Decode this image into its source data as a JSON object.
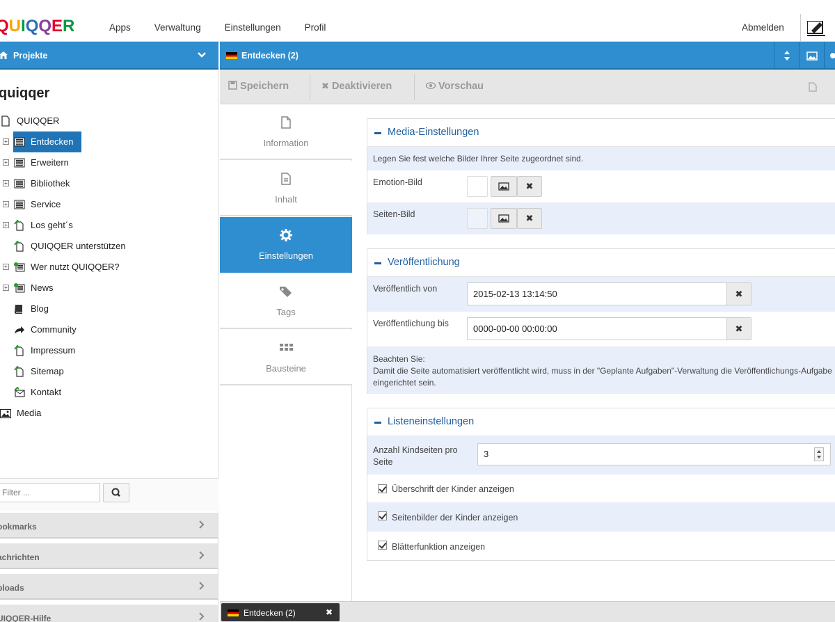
{
  "app": {
    "logo_text": "QUIQQER",
    "logo_colors": [
      "#e4002b",
      "#f7a600",
      "#009a44",
      "#2e6db4",
      "#8b3f98",
      "#e4002b",
      "#009a44"
    ]
  },
  "topmenu": {
    "items": [
      "Apps",
      "Verwaltung",
      "Einstellungen",
      "Profil"
    ],
    "logout": "Abmelden"
  },
  "sidebar": {
    "header": "Projekte",
    "project_title": "quiqqer",
    "tree": [
      {
        "label": "QUIQQER",
        "icon": "page-icon",
        "expandable": false,
        "selected": false
      },
      {
        "label": "Entdecken",
        "icon": "list-icon",
        "expandable": true,
        "selected": true
      },
      {
        "label": "Erweitern",
        "icon": "list-icon",
        "expandable": true,
        "selected": false
      },
      {
        "label": "Bibliothek",
        "icon": "list-icon",
        "expandable": true,
        "selected": false
      },
      {
        "label": "Service",
        "icon": "list-icon",
        "expandable": true,
        "selected": false
      },
      {
        "label": "Los geht´s",
        "icon": "page-link-icon",
        "expandable": true,
        "selected": false
      },
      {
        "label": "QUIQQER unterstützen",
        "icon": "page-link-icon",
        "expandable": false,
        "selected": false
      },
      {
        "label": "Wer nutzt QUIQQER?",
        "icon": "list-link-icon",
        "expandable": true,
        "selected": false
      },
      {
        "label": "News",
        "icon": "list-link-icon",
        "expandable": true,
        "selected": false
      },
      {
        "label": "Blog",
        "icon": "book-icon",
        "expandable": false,
        "selected": false
      },
      {
        "label": "Community",
        "icon": "share-arrow-icon",
        "expandable": false,
        "selected": false
      },
      {
        "label": "Impressum",
        "icon": "page-link-icon",
        "expandable": false,
        "selected": false
      },
      {
        "label": "Sitemap",
        "icon": "page-link-icon",
        "expandable": false,
        "selected": false
      },
      {
        "label": "Kontakt",
        "icon": "mail-link-icon",
        "expandable": false,
        "selected": false
      },
      {
        "label": "Media",
        "icon": "image-icon",
        "expandable": false,
        "selected": false
      }
    ],
    "filter_placeholder": "Filter ...",
    "panels": [
      "ookmarks",
      "achrichten",
      "ploads",
      "UIQQER-Hilfe"
    ]
  },
  "main": {
    "title": "Entdecken (2)",
    "toolbar": {
      "save": "Speichern",
      "deactivate": "Deaktivieren",
      "preview": "Vorschau"
    },
    "tabs": [
      {
        "label": "Information",
        "icon": "file-icon",
        "active": false
      },
      {
        "label": "Inhalt",
        "icon": "file-text-icon",
        "active": false
      },
      {
        "label": "Einstellungen",
        "icon": "gear-icon",
        "active": true
      },
      {
        "label": "Tags",
        "icon": "tags-icon",
        "active": false
      },
      {
        "label": "Bausteine",
        "icon": "grid-icon",
        "active": false
      }
    ],
    "media": {
      "title": "Media-Einstellungen",
      "description": "Legen Sie fest welche Bilder Ihrer Seite zugeordnet sind.",
      "emotion_label": "Emotion-Bild",
      "page_image_label": "Seiten-Bild"
    },
    "publish": {
      "title": "Veröffentlichung",
      "from_label": "Veröffentlich von",
      "from_value": "2015-02-13 13:14:50",
      "to_label": "Veröffentlichung bis",
      "to_value": "0000-00-00 00:00:00",
      "note_title": "Beachten Sie:",
      "note_text": "Damit die Seite automatisiert veröffentlicht wird, muss in der \"Geplante Aufgaben\"-Verwaltung die Veröffentlichungs-Aufgabe eingerichtet sein."
    },
    "list": {
      "title": "Listeneinstellungen",
      "count_label": "Anzahl Kindseiten pro Seite",
      "count_value": "3",
      "opt_headings": "Überschrift der Kinder anzeigen",
      "opt_images": "Seitenbilder der Kinder anzeigen",
      "opt_paging": "Blätterfunktion anzeigen",
      "opt_headings_checked": true,
      "opt_images_checked": true,
      "opt_paging_checked": true
    }
  },
  "taskbar": {
    "tab_label": "Entdecken (2)"
  },
  "colors": {
    "accent": "#2f8ecf",
    "selected": "#1f74b7",
    "row_alt": "#e8eefa",
    "section_title": "#1f5f9e"
  }
}
